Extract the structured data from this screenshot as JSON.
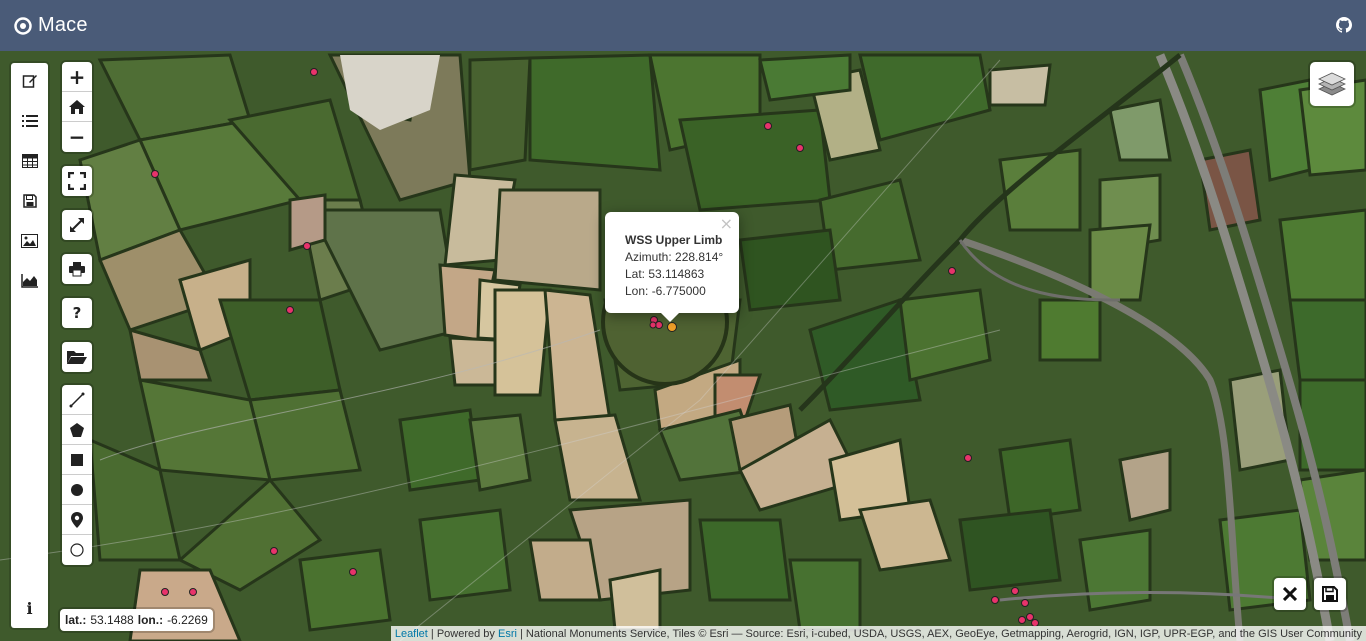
{
  "app": {
    "title": "Mace"
  },
  "sidebar": {
    "items": [
      {
        "icon": "edit-icon"
      },
      {
        "icon": "list-icon"
      },
      {
        "icon": "table-icon"
      },
      {
        "icon": "save-icon"
      },
      {
        "icon": "image-icon"
      },
      {
        "icon": "area-chart-icon"
      },
      {
        "icon": "info-icon",
        "label": "i"
      }
    ]
  },
  "zoom": {
    "in": "+",
    "out": "−"
  },
  "help": {
    "label": "?"
  },
  "popup": {
    "title": "WSS Upper Limb",
    "azimuth": "Azimuth: 228.814°",
    "lat": "Lat: 53.114863",
    "lon": "Lon: -6.775000",
    "close": "×"
  },
  "coords": {
    "lat_label": "lat.:",
    "lat_value": "53.1488",
    "lon_label": "lon.:",
    "lon_value": "-6.2269"
  },
  "attribution": {
    "leaflet": "Leaflet",
    "sep": " | Powered by ",
    "esri": "Esri",
    "rest": " | National Monuments Service, Tiles © Esri — Source: Esri, i-cubed, USDA, USGS, AEX, GeoEye, Getmapping, Aerogrid, IGN, IGP, UPR-EGP, and the GIS User Community"
  },
  "colors": {
    "header": "#4a5b78",
    "marker": "#e8336b",
    "selected_marker": "#f0a028"
  }
}
